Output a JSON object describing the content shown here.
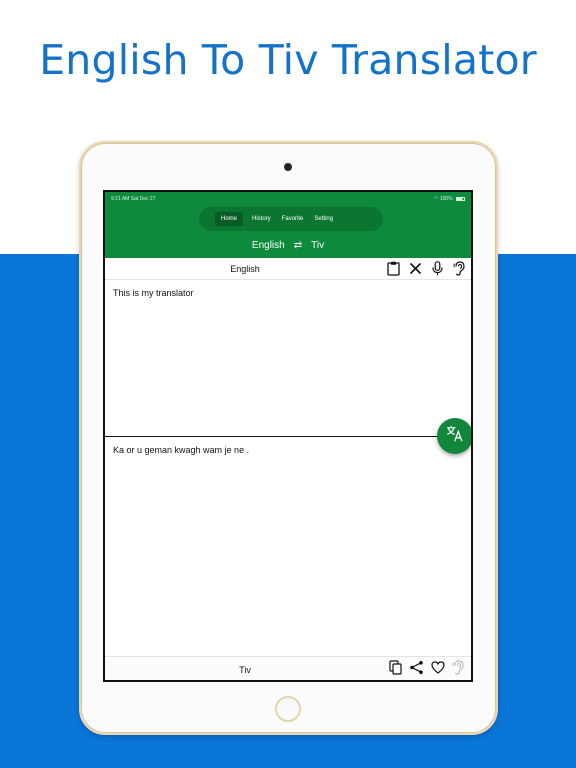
{
  "headline": "English To Tiv Translator",
  "status_bar": {
    "time": "9:21 AM  Sat Dec 27",
    "battery": "100%"
  },
  "tabs": [
    {
      "label": "Home",
      "active": true
    },
    {
      "label": "History",
      "active": false
    },
    {
      "label": "Favorite",
      "active": false
    },
    {
      "label": "Setting",
      "active": false
    }
  ],
  "language_bar": {
    "source": "English",
    "swap": "⇄",
    "target": "Tiv"
  },
  "source_panel": {
    "language": "English",
    "text": "This is my translator"
  },
  "target_panel": {
    "language": "Tiv",
    "text": "Ka or u geman kwagh wam je ne ."
  },
  "icons": {
    "source": [
      "clipboard-icon",
      "close-icon",
      "microphone-icon",
      "speaker-ear-icon"
    ],
    "target": [
      "copy-icon",
      "share-icon",
      "heart-icon",
      "speaker-ear-icon"
    ],
    "fab": "translate-icon"
  },
  "colors": {
    "header": "#0d8a3c",
    "fab": "#12873b",
    "background": "#0a76d8",
    "headline": "#1473c8"
  }
}
